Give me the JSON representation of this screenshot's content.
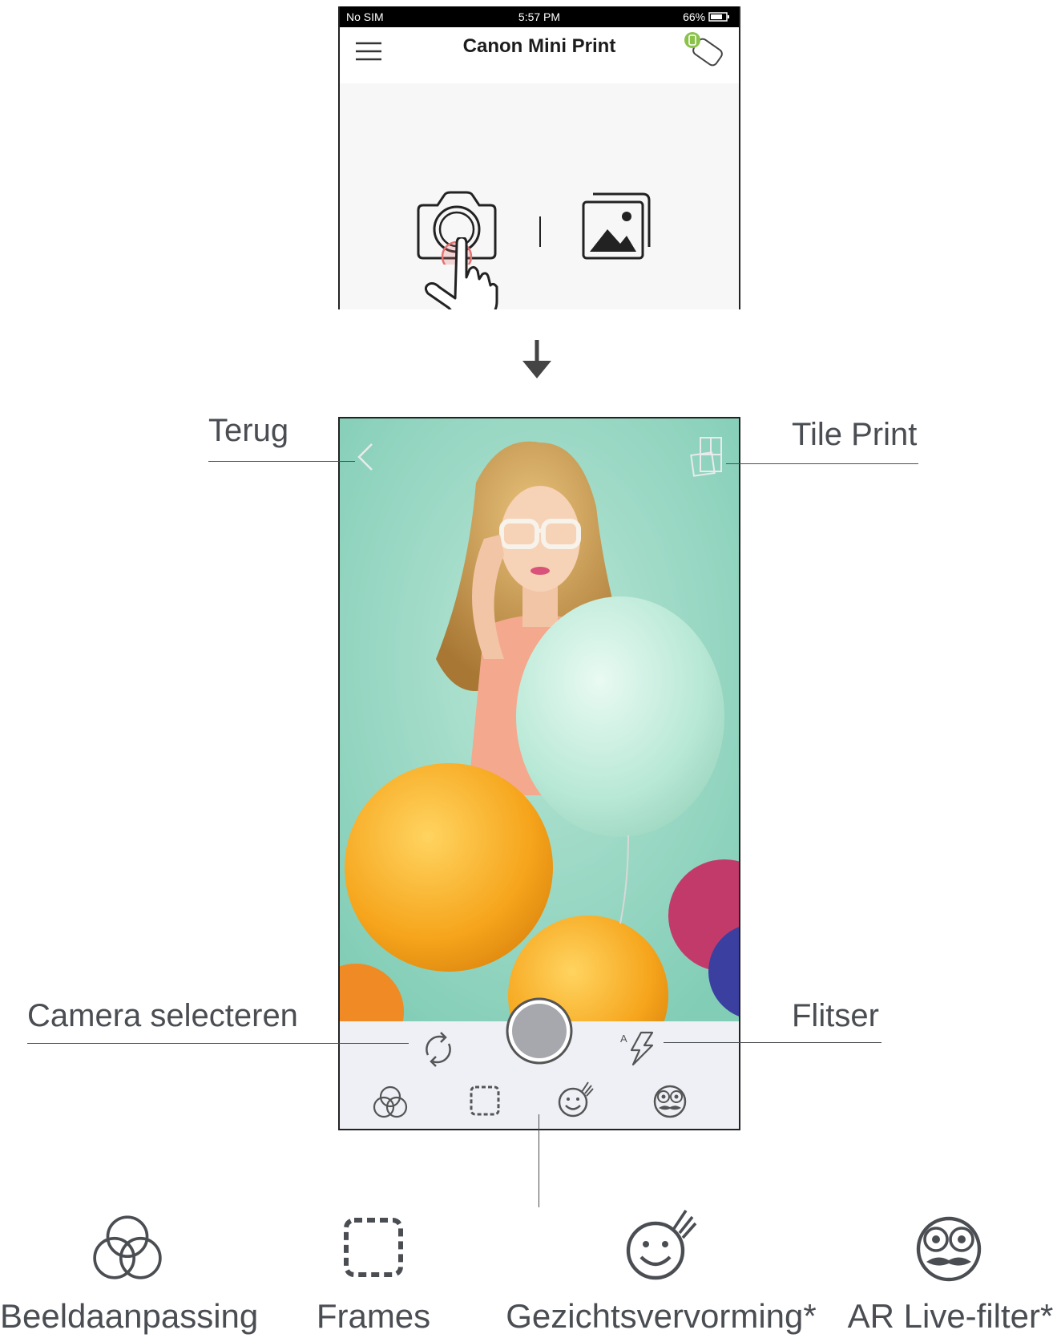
{
  "status_bar": {
    "carrier": "No SIM",
    "time": "5:57 PM",
    "battery": "66%"
  },
  "app": {
    "title": "Canon Mini Print"
  },
  "icons": {
    "menu": "hamburger-menu-icon",
    "printer": "printer-connected-icon",
    "camera": "camera-icon",
    "gallery": "gallery-icon",
    "hand": "tap-hand-icon",
    "arrow": "arrow-down-icon",
    "back": "back-chevron-icon",
    "tile_print": "tile-print-icon",
    "switch_camera": "switch-camera-icon",
    "flash": "flash-auto-icon",
    "shutter": "shutter-button",
    "filters": "filters-icon",
    "frames": "frames-icon",
    "face_warp": "face-warp-icon",
    "ar_filter": "ar-mask-icon"
  },
  "callouts": {
    "back": "Terug",
    "tile_print": "Tile Print",
    "camera_select": "Camera selecteren",
    "flash": "Flitser"
  },
  "features": [
    {
      "label": "Beeldaanpassing"
    },
    {
      "label": "Frames"
    },
    {
      "label": "Gezichtsvervorming*"
    },
    {
      "label": "AR Live-filter*"
    }
  ],
  "colors": {
    "label_text": "#4a4d52",
    "photo_background": "#9fdac8",
    "control_bar": "#eef0f6",
    "printer_led": "#8bc34a",
    "tap_highlight": "#e57373"
  }
}
